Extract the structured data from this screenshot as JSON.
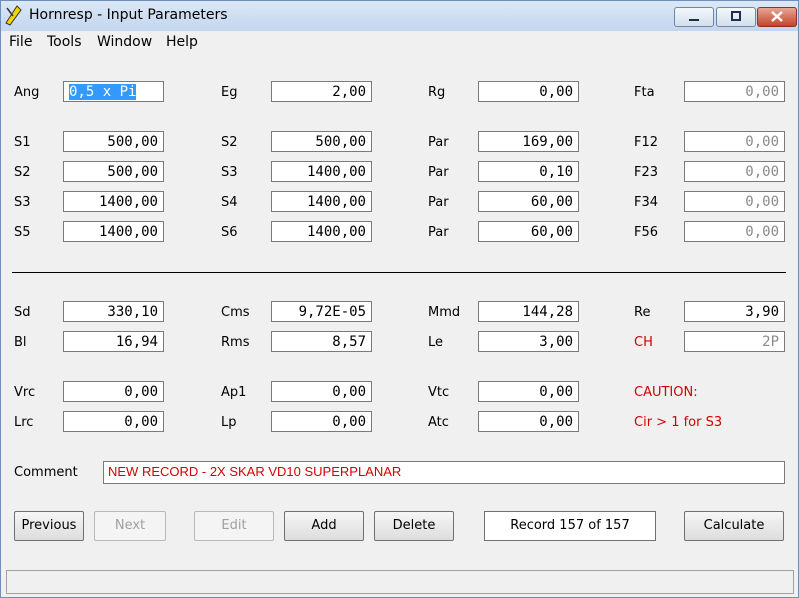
{
  "window": {
    "title": "Hornresp - Input Parameters"
  },
  "menu": [
    "File",
    "Tools",
    "Window",
    "Help"
  ],
  "params": {
    "Ang": "0,5 x Pi",
    "Eg": "2,00",
    "Rg": "0,00",
    "Fta": "0,00",
    "S1": "500,00",
    "S2a": "500,00",
    "Par1": "169,00",
    "F12": "0,00",
    "S2": "500,00",
    "S3a": "1400,00",
    "Par2": "0,10",
    "F23": "0,00",
    "S3": "1400,00",
    "S4": "1400,00",
    "Par3": "60,00",
    "F34": "0,00",
    "S5": "1400,00",
    "S6": "1400,00",
    "Par4": "60,00",
    "F56": "0,00",
    "Sd": "330,10",
    "Cms": "9,72E-05",
    "Mmd": "144,28",
    "Re": "3,90",
    "Bl": "16,94",
    "Rms": "8,57",
    "Le": "3,00",
    "CH": "2P",
    "Vrc": "0,00",
    "Ap1": "0,00",
    "Vtc": "0,00",
    "Lrc": "0,00",
    "Lp": "0,00",
    "Atc": "0,00"
  },
  "labels": {
    "Ang": "Ang",
    "Eg": "Eg",
    "Rg": "Rg",
    "Fta": "Fta",
    "S1": "S1",
    "S2": "S2",
    "Par": "Par",
    "F12": "F12",
    "S3": "S3",
    "F23": "F23",
    "S4": "S4",
    "F34": "F34",
    "S5": "S5",
    "S6": "S6",
    "F56": "F56",
    "Sd": "Sd",
    "Cms": "Cms",
    "Mmd": "Mmd",
    "Re": "Re",
    "Bl": "Bl",
    "Rms": "Rms",
    "Le": "Le",
    "CH": "CH",
    "Vrc": "Vrc",
    "Ap1": "Ap1",
    "Vtc": "Vtc",
    "Lrc": "Lrc",
    "Lp": "Lp",
    "Atc": "Atc",
    "Comment": "Comment"
  },
  "caution": {
    "title": "CAUTION:",
    "message": "Cir > 1 for S3"
  },
  "comment": "NEW RECORD - 2X SKAR VD10 SUPERPLANAR",
  "buttons": {
    "previous": "Previous",
    "next": "Next",
    "edit": "Edit",
    "add": "Add",
    "delete": "Delete",
    "calculate": "Calculate"
  },
  "record": "Record 157 of 157",
  "colors": {
    "warning": "#d40000",
    "selection": "#3399ff"
  }
}
